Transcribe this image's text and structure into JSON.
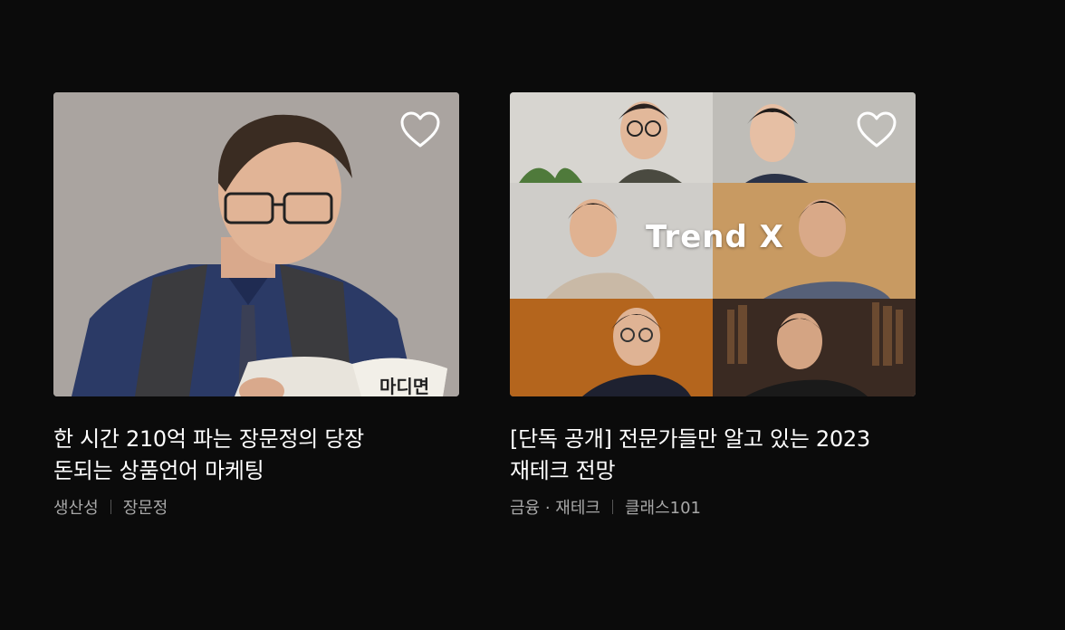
{
  "cards": [
    {
      "title_line1": "한 시간 210억 파는 장문정의 당장",
      "title_line2": "돈되는 상품언어 마케팅",
      "category": "생산성",
      "creator": "장문정",
      "favorite_icon": "heart-outline-icon"
    },
    {
      "title_line1": "[단독 공개] 전문가들만 알고 있는 2023",
      "title_line2": "재테크 전망",
      "category": "금융 · 재테크",
      "creator": "클래스101",
      "thumbnail_text": "Trend X",
      "favorite_icon": "heart-outline-icon"
    }
  ],
  "colors": {
    "background": "#0b0b0b",
    "title": "#ffffff",
    "meta": "#a8a8a8"
  }
}
